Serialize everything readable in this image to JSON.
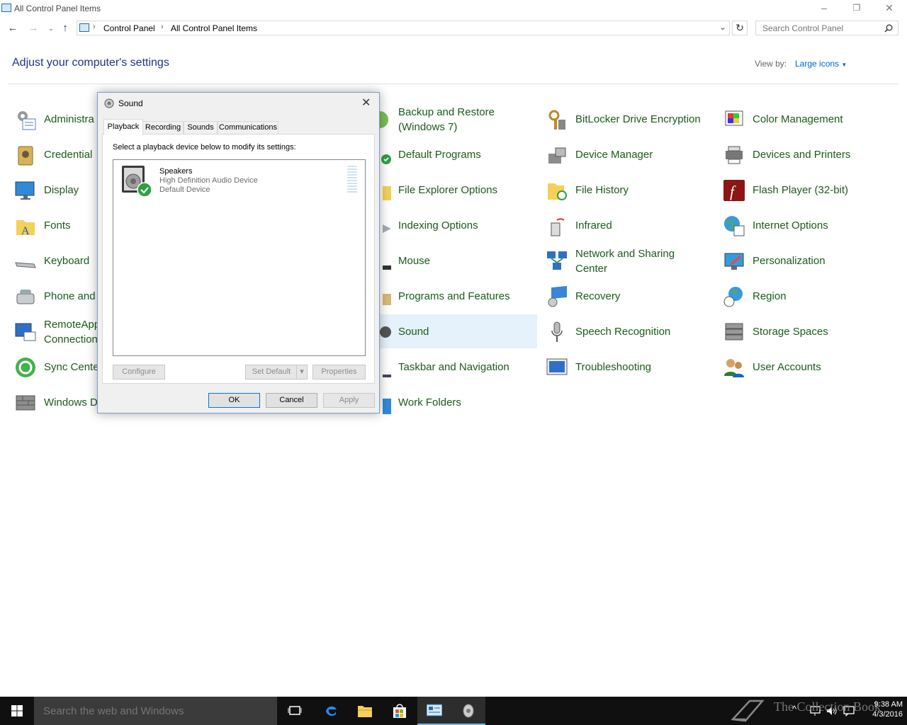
{
  "window": {
    "title": "All Control Panel Items",
    "controls": {
      "minimize": "–",
      "restore": "❐",
      "close": "✕"
    }
  },
  "address": {
    "crumbs": [
      "Control Panel",
      "All Control Panel Items"
    ],
    "search_placeholder": "Search Control Panel"
  },
  "header": {
    "title": "Adjust your computer's settings",
    "view_by_label": "View by:",
    "view_by_value": "Large icons"
  },
  "items": {
    "col1": [
      "Administra",
      "Credential",
      "Display",
      "Fonts",
      "Keyboard",
      "Phone and",
      "RemoteApp",
      "Sync Cente",
      "Windows D"
    ],
    "col1_line2": {
      "remoteapp": "Connection"
    },
    "col2": {
      "backup_l1": "Backup and Restore",
      "backup_l2": "(Windows 7)",
      "default_programs": "Default Programs",
      "file_explorer": "File Explorer Options",
      "indexing": "Indexing Options",
      "mouse": "Mouse",
      "programs": "Programs and Features",
      "sound": "Sound",
      "taskbar": "Taskbar and Navigation",
      "work_folders": "Work Folders"
    },
    "col3": {
      "bitlocker": "BitLocker Drive Encryption",
      "device_manager": "Device Manager",
      "file_history": "File History",
      "infrared": "Infrared",
      "network_l1": "Network and Sharing",
      "network_l2": "Center",
      "recovery": "Recovery",
      "speech": "Speech Recognition",
      "troubleshooting": "Troubleshooting"
    },
    "col4": {
      "color": "Color Management",
      "devices": "Devices and Printers",
      "flash": "Flash Player (32-bit)",
      "internet": "Internet Options",
      "personalization": "Personalization",
      "region": "Region",
      "storage": "Storage Spaces",
      "users": "User Accounts"
    }
  },
  "dialog": {
    "title": "Sound",
    "tabs": [
      "Playback",
      "Recording",
      "Sounds",
      "Communications"
    ],
    "instruction": "Select a playback device below to modify its settings:",
    "device": {
      "name": "Speakers",
      "driver": "High Definition Audio Device",
      "status": "Default Device"
    },
    "buttons": {
      "configure": "Configure",
      "set_default": "Set Default",
      "properties": "Properties",
      "ok": "OK",
      "cancel": "Cancel",
      "apply": "Apply"
    }
  },
  "taskbar": {
    "search_placeholder": "Search the web and Windows",
    "time": "9:38 AM",
    "date": "4/3/2016",
    "watermark": "The Collection Book"
  }
}
